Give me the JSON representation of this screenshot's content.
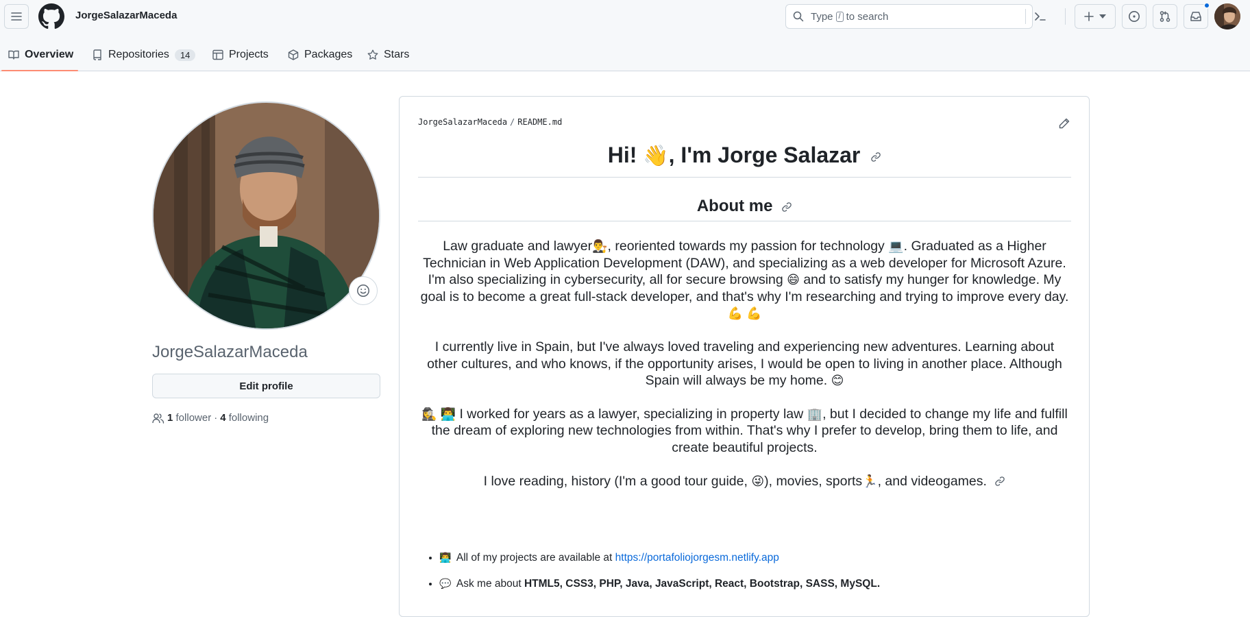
{
  "header": {
    "username": "JorgeSalazarMaceda",
    "search": {
      "type_label": "Type",
      "key": "/",
      "suffix": "to search"
    }
  },
  "tabs": [
    {
      "label": "Overview",
      "icon": "book-icon"
    },
    {
      "label": "Repositories",
      "icon": "repo-icon",
      "count": "14"
    },
    {
      "label": "Projects",
      "icon": "table-icon"
    },
    {
      "label": "Packages",
      "icon": "package-icon"
    },
    {
      "label": "Stars",
      "icon": "star-icon"
    }
  ],
  "sidebar": {
    "name": "JorgeSalazarMaceda",
    "edit_profile": "Edit profile",
    "followers_count": "1",
    "followers_label": "follower",
    "dot": "·",
    "following_count": "4",
    "following_label": "following"
  },
  "readme": {
    "path_owner": "JorgeSalazarMaceda",
    "path_sep": "/",
    "path_file": "README.md",
    "h1_pre": "Hi!",
    "h1_emoji": "👋",
    "h1_post": ", I'm Jorge Salazar",
    "h2": "About me",
    "p1_a": "Law graduate and lawyer",
    "p1_e1": "👨‍⚖️",
    "p1_b": ", reoriented towards my passion for technology",
    "p1_e2": "💻",
    "p1_c": ". Graduated as a Higher Technician in Web Application Development (DAW), and specializing as a web developer for Microsoft Azure. I'm also specializing in cybersecurity, all for secure browsing",
    "p1_e3": "😄",
    "p1_d": "and to satisfy my hunger for knowledge. My goal is to become a great full-stack developer, and that's why I'm researching and trying to improve every day.",
    "p1_e4": "💪 💪",
    "p2": "I currently live in Spain, but I've always loved traveling and experiencing new adventures. Learning about other cultures, and who knows, if the opportunity arises, I would be open to living in another place. Although Spain will always be my home.",
    "p2_e": "😊",
    "p3_e1": "🕵️‍♀️ 👨‍💻",
    "p3_a": "I worked for years as a lawyer, specializing in property law",
    "p3_e2": "🏢",
    "p3_b": ", but I decided to change my life and fulfill the dream of exploring new technologies from within. That's why I prefer to develop, bring them to life, and create beautiful projects.",
    "p4_a": "I love reading, history (I'm a good tour guide,",
    "p4_e1": "😜",
    "p4_b": "), movies, sports",
    "p4_e2": "🏃",
    "p4_c": ", and videogames.",
    "list": [
      {
        "emoji": "👨‍💻",
        "text": "All of my projects are available at",
        "link": "https://portafoliojorgesm.netlify.app"
      },
      {
        "emoji": "💬",
        "text": "Ask me about",
        "bold": "HTML5, CSS3, PHP, Java, JavaScript, React, Bootstrap, SASS, MySQL."
      }
    ]
  }
}
